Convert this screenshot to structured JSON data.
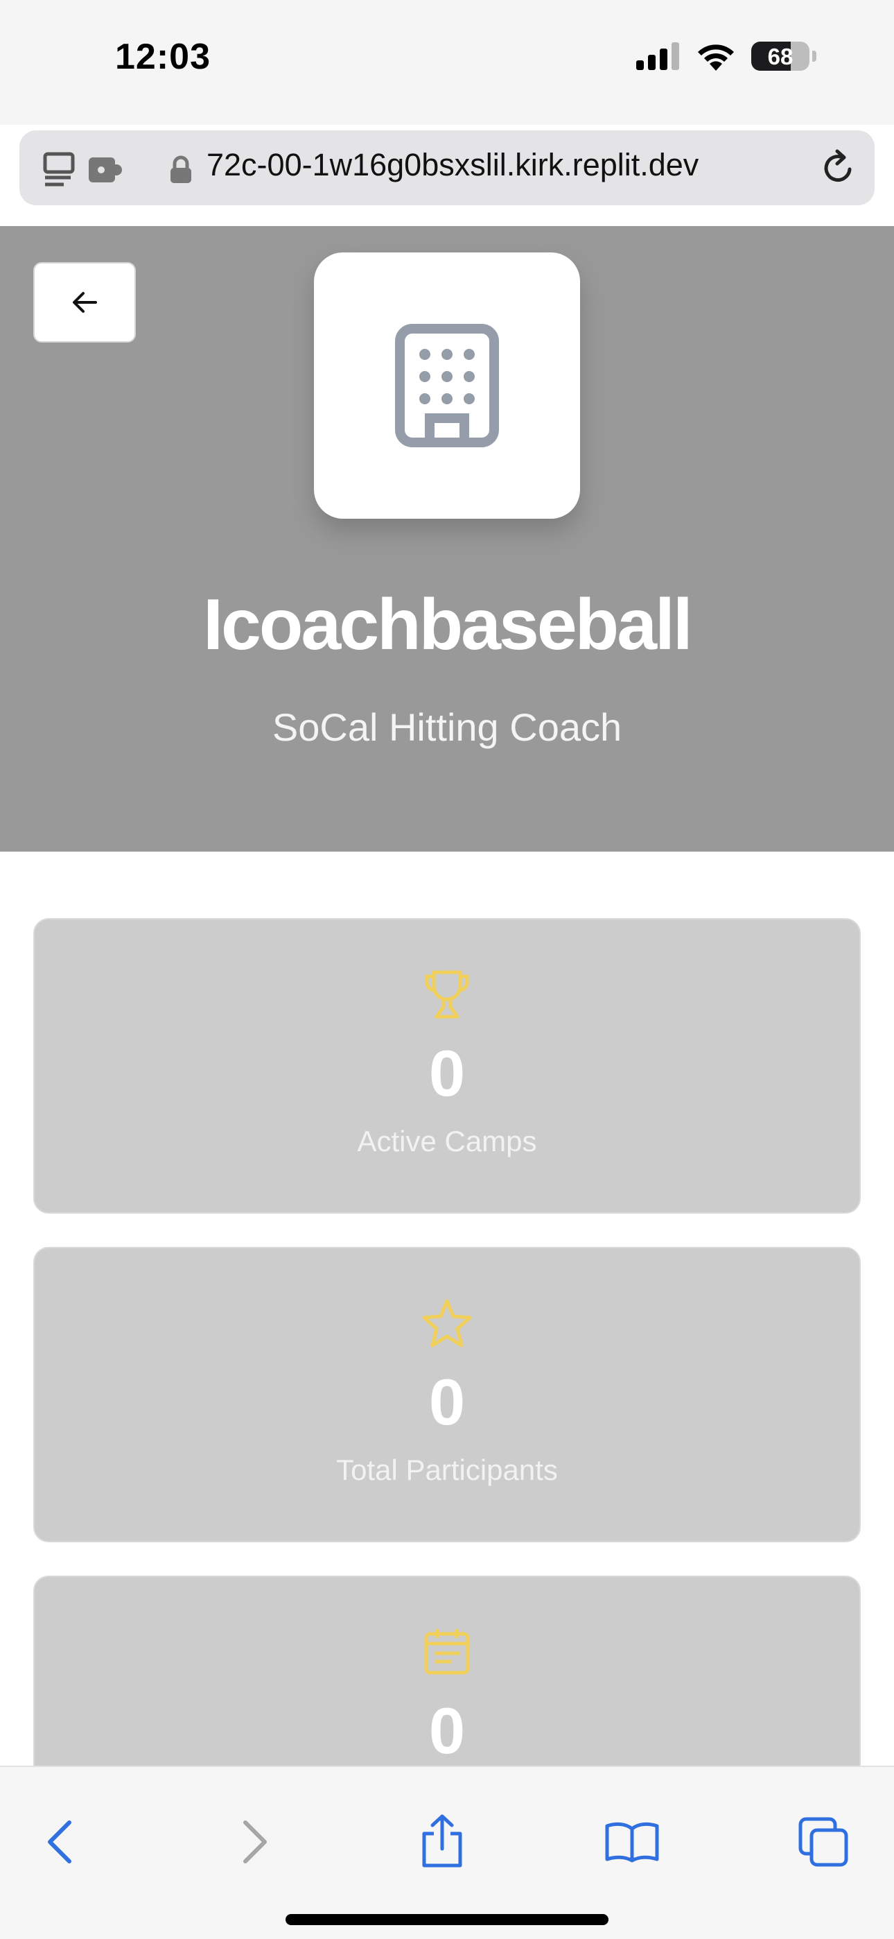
{
  "status_bar": {
    "time": "12:03",
    "battery": "68",
    "battery_level": 0.68,
    "icons": [
      "cellular-signal-icon",
      "wifi-icon",
      "battery-icon"
    ]
  },
  "browser": {
    "url": "72c-00-1w16g0bsxslil.kirk.replit.dev",
    "icons": [
      "tab-overview-icon",
      "extensions-icon",
      "lock-icon",
      "reload-icon"
    ]
  },
  "profile": {
    "name": "Icoachbaseball",
    "subtitle": "SoCal Hitting Coach",
    "logo_icon": "building-icon",
    "back_icon": "arrow-left-icon"
  },
  "stats": [
    {
      "value": "0",
      "label": "Active Camps",
      "icon": "trophy-icon"
    },
    {
      "value": "0",
      "label": "Total Participants",
      "icon": "star-icon"
    },
    {
      "value": "0",
      "label": "",
      "icon": "calendar-icon"
    }
  ],
  "toolbar": {
    "items": [
      "back-icon",
      "forward-icon",
      "share-icon",
      "bookmarks-icon",
      "tabs-icon"
    ]
  },
  "colors": {
    "hero_bg": "#999999",
    "card_bg": "#cccccc",
    "accent_yellow": "#f0cf5a",
    "ios_blue": "#2f6fe0"
  }
}
